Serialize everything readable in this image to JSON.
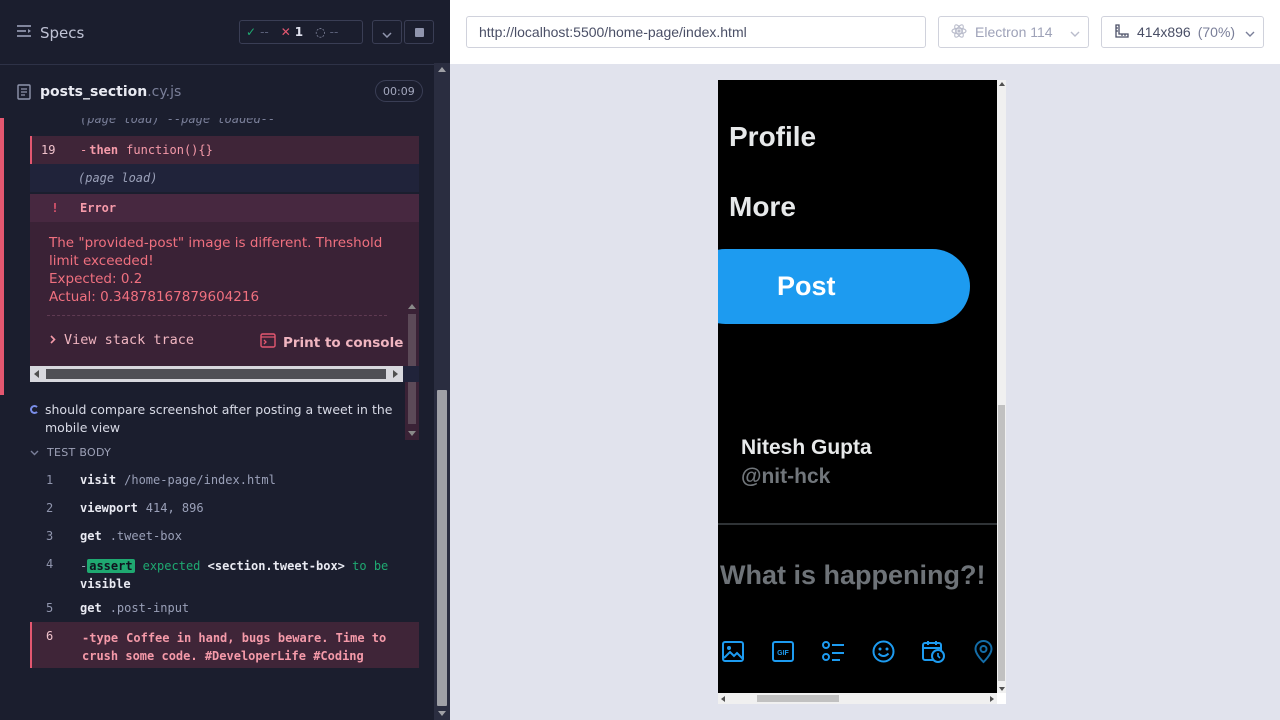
{
  "header": {
    "specs_label": "Specs",
    "stats": {
      "passed": "--",
      "failed": "1",
      "pending": "--"
    },
    "menu_icon": "list-icon",
    "expand_icon": "chevron-down-icon",
    "stop_icon": "stop-icon"
  },
  "spec": {
    "file_name": "posts_section",
    "file_ext": ".cy.js",
    "duration": "00:09"
  },
  "commands_before": {
    "previous_line": "(page load)  --page loaded--",
    "failed": {
      "line": "19",
      "prefix": "-",
      "name": "then",
      "arg": "function(){}"
    },
    "sub": {
      "arg": "(page load)"
    }
  },
  "error": {
    "bang": "!",
    "title": "Error",
    "message_lines": [
      "The \"provided-post\" image is different. Threshold",
      "limit exceeded!",
      "Expected: 0.2",
      "Actual: 0.34878167879604216"
    ],
    "stack_trace_label": "View stack trace",
    "print_console_label": "Print to console"
  },
  "test": {
    "title": "should compare screenshot after posting a tweet in the mobile view",
    "body_label": "TEST BODY"
  },
  "test_body": [
    {
      "line": "1",
      "name": "visit",
      "arg": "/home-page/index.html"
    },
    {
      "line": "2",
      "name": "viewport",
      "arg": "414, 896"
    },
    {
      "line": "3",
      "name": "get",
      "arg": ".tweet-box"
    },
    {
      "line": "4",
      "prefix": "-",
      "tag": "assert",
      "text_a": "expected",
      "text_b": "<section.tweet-box>",
      "text_c": "to be",
      "text_d": "visible"
    },
    {
      "line": "5",
      "name": "get",
      "arg": ".post-input"
    },
    {
      "line": "6",
      "prefix": "-",
      "name": "type",
      "arg": "Coffee in hand, bugs beware. Time to crush some code. #DeveloperLife #Coding"
    }
  ],
  "browser": {
    "url": "http://localhost:5500/home-page/index.html",
    "browser_name": "Electron 114",
    "viewport": "414x896",
    "scale": "(70%)"
  },
  "aut": {
    "nav_profile": "Profile",
    "nav_more": "More",
    "post_button": "Post",
    "user_name": "Nitesh Gupta",
    "user_handle": "@nit-hck",
    "tweet_placeholder": "What is happening?!",
    "tool_icons": [
      "image-icon",
      "gif-icon",
      "poll-icon",
      "emoji-icon",
      "schedule-icon",
      "location-icon"
    ],
    "accent": "#1d9bf0"
  },
  "colors": {
    "fail": "#e45770",
    "pass": "#1fa971",
    "reporter_bg": "#1b1e2e"
  }
}
